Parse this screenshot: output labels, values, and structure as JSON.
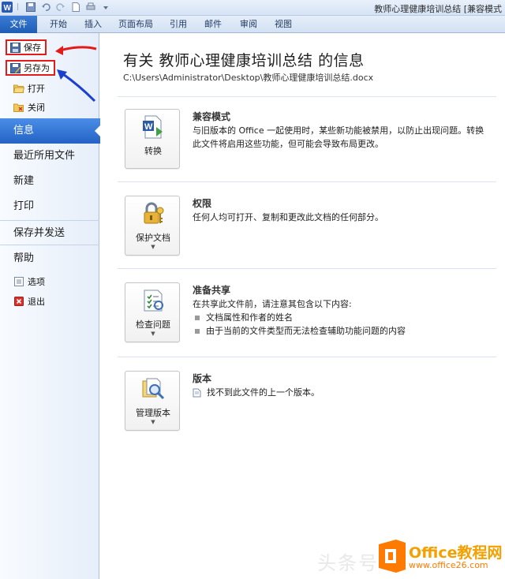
{
  "window": {
    "title": "教师心理健康培训总结 [兼容模式"
  },
  "ribbon": {
    "tabs": [
      "文件",
      "开始",
      "插入",
      "页面布局",
      "引用",
      "邮件",
      "审阅",
      "视图"
    ],
    "active_tab": "文件"
  },
  "backstage_nav": {
    "commands": [
      {
        "label": "保存",
        "icon": "save-icon"
      },
      {
        "label": "另存为",
        "icon": "save-as-icon"
      },
      {
        "label": "打开",
        "icon": "open-folder-icon"
      },
      {
        "label": "关闭",
        "icon": "close-folder-icon"
      }
    ],
    "items": [
      {
        "label": "信息",
        "active": true
      },
      {
        "label": "最近所用文件"
      },
      {
        "label": "新建"
      },
      {
        "label": "打印"
      },
      {
        "label": "保存并发送"
      },
      {
        "label": "帮助"
      }
    ],
    "footer_commands": [
      {
        "label": "选项",
        "icon": "options-icon"
      },
      {
        "label": "退出",
        "icon": "exit-icon"
      }
    ]
  },
  "info": {
    "title": "有关 教师心理健康培训总结 的信息",
    "path": "C:\\Users\\Administrator\\Desktop\\教师心理健康培训总结.docx",
    "sections": [
      {
        "button_label": "转换",
        "icon": "convert-icon",
        "has_dropdown": false,
        "heading": "兼容模式",
        "text": "与旧版本的 Office 一起使用时，某些新功能被禁用，以防止出现问题。转换此文件将启用这些功能，但可能会导致布局更改。"
      },
      {
        "button_label": "保护文档",
        "icon": "lock-key-icon",
        "has_dropdown": true,
        "heading": "权限",
        "text": "任何人均可打开、复制和更改此文档的任何部分。"
      },
      {
        "button_label": "检查问题",
        "icon": "inspect-checklist-icon",
        "has_dropdown": true,
        "heading": "准备共享",
        "text": "在共享此文件前，请注意其包含以下内容:",
        "bullets": [
          "文档属性和作者的姓名",
          "由于当前的文件类型而无法检查辅助功能问题的内容"
        ]
      },
      {
        "button_label": "管理版本",
        "icon": "versions-magnifier-icon",
        "has_dropdown": true,
        "heading": "版本",
        "text": "找不到此文件的上一个版本。"
      }
    ]
  },
  "watermark": {
    "toutiao": "头条号",
    "brand": "Office教程网",
    "url": "www.office26.com"
  },
  "colors": {
    "file_tab": "#2462c4",
    "active_nav": "#3a7ad8",
    "annotation_red": "#e21b1b",
    "annotation_blue": "#1b3fd1"
  }
}
